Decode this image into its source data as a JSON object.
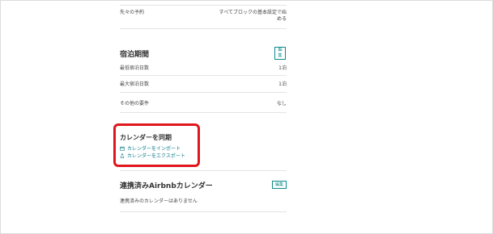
{
  "booking": {
    "label": "先々の予約",
    "value_line1": "すべてブロックの基本設定で始",
    "value_line2": "める"
  },
  "stay": {
    "title": "宿泊期間",
    "edit_label": "編\n集",
    "rows": [
      {
        "label": "最低宿泊日数",
        "value": "1泊"
      },
      {
        "label": "最大宿泊日数",
        "value": "1泊"
      },
      {
        "label": "その他の要件",
        "value": "なし"
      }
    ]
  },
  "sync": {
    "title": "カレンダーを同期",
    "import_label": "カレンダーをインポート",
    "export_label": "カレンダーをエクスポート",
    "highlight_color": "#e0161c"
  },
  "linked": {
    "title": "連携済みAirbnbカレンダー",
    "edit_label": "編集",
    "empty_text": "連携済みのカレンダーはありません"
  },
  "colors": {
    "accent": "#0b8a8a"
  }
}
